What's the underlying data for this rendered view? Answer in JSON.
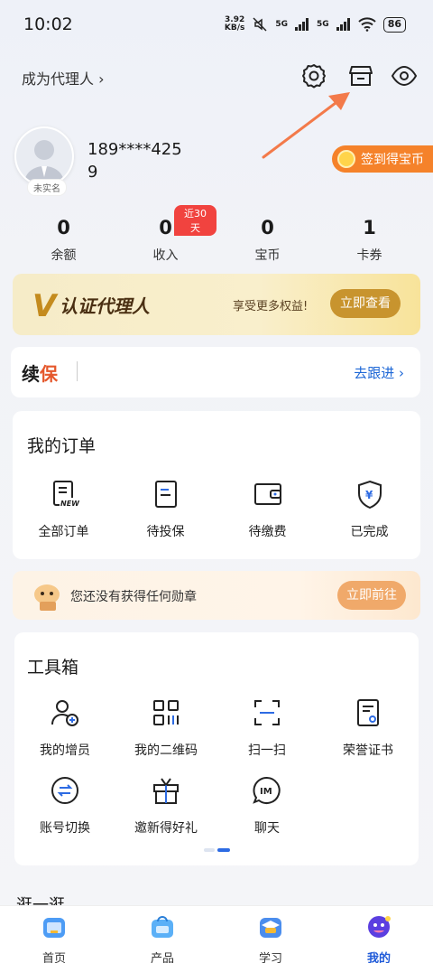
{
  "status": {
    "time": "10:02",
    "speed": "3.92",
    "speed_unit": "KB/s",
    "signal1": "5G",
    "signal2": "5G",
    "battery": "86"
  },
  "header": {
    "agent_link": "成为代理人 ›"
  },
  "profile": {
    "phone": "189****4259",
    "tag": "未实名",
    "signin": "签到得宝币"
  },
  "stats": [
    {
      "value": "0",
      "label": "余额"
    },
    {
      "value": "0",
      "label": "收入",
      "badge": "近30天"
    },
    {
      "value": "0",
      "label": "宝币"
    },
    {
      "value": "1",
      "label": "卡券"
    }
  ],
  "agent_banner": {
    "logo": "V",
    "title": "认证代理人",
    "subtitle": "享受更多权益!",
    "button": "立即查看"
  },
  "renewal": {
    "logo_a": "续",
    "logo_b": "保",
    "link": "去跟进 ›"
  },
  "orders": {
    "title": "我的订单",
    "items": [
      {
        "label": "全部订单",
        "icon": "clipboard-new-icon"
      },
      {
        "label": "待投保",
        "icon": "document-icon"
      },
      {
        "label": "待缴费",
        "icon": "wallet-icon"
      },
      {
        "label": "已完成",
        "icon": "shield-yen-icon"
      }
    ]
  },
  "medal": {
    "text": "您还没有获得任何勋章",
    "button": "立即前往"
  },
  "tools": {
    "title": "工具箱",
    "row1": [
      {
        "label": "我的增员",
        "icon": "add-user-icon"
      },
      {
        "label": "我的二维码",
        "icon": "qrcode-icon"
      },
      {
        "label": "扫一扫",
        "icon": "scan-icon"
      },
      {
        "label": "荣誉证书",
        "icon": "certificate-icon"
      }
    ],
    "row2": [
      {
        "label": "账号切换",
        "icon": "switch-account-icon"
      },
      {
        "label": "邀新得好礼",
        "icon": "gift-icon"
      },
      {
        "label": "聊天",
        "icon": "chat-im-icon"
      }
    ],
    "im_text": "IM"
  },
  "browse": {
    "title": "逛一逛"
  },
  "tabbar": [
    {
      "label": "首页",
      "color": "#3a8ef0"
    },
    {
      "label": "产品",
      "color": "#4aa8f5"
    },
    {
      "label": "学习",
      "color": "#3a7fe8"
    },
    {
      "label": "我的",
      "color": "#5b3fe0",
      "active": true
    }
  ]
}
